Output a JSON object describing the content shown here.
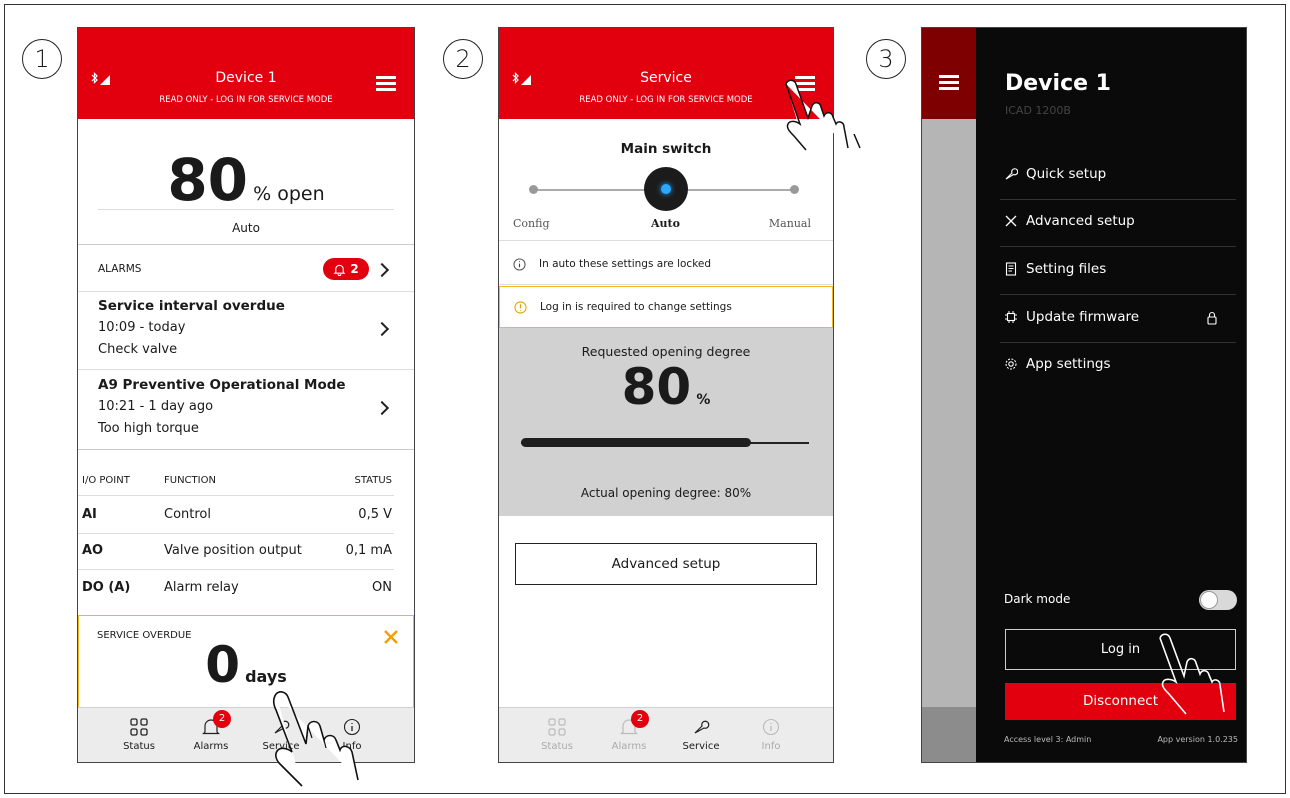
{
  "steps": [
    "1",
    "2",
    "3"
  ],
  "screen1": {
    "title": "Device 1",
    "subtitle": "READ ONLY - LOG IN FOR SERVICE MODE",
    "opening_value": "80",
    "opening_unit": "% open",
    "mode": "Auto",
    "alarms_label": "ALARMS",
    "alarm_count": "2",
    "alarms": [
      {
        "title": "Service interval overdue",
        "time": "10:09 - today",
        "detail": "Check valve"
      },
      {
        "title": "A9 Preventive Operational Mode",
        "time": "10:21 - 1 day ago",
        "detail": "Too high torque"
      }
    ],
    "io_headers": [
      "I/O POINT",
      "FUNCTION",
      "STATUS"
    ],
    "io_rows": [
      {
        "point": "AI",
        "function": "Control",
        "status": "0,5 V"
      },
      {
        "point": "AO",
        "function": "Valve position output",
        "status": "0,1 mA"
      },
      {
        "point": "DO (A)",
        "function": "Alarm relay",
        "status": "ON"
      }
    ],
    "service_label": "SERVICE OVERDUE",
    "service_value": "0",
    "service_unit": "days",
    "tabs": [
      "Status",
      "Alarms",
      "Service",
      "Info"
    ],
    "tab_badge": "2"
  },
  "screen2": {
    "title": "Service",
    "subtitle": "READ ONLY - LOG IN FOR SERVICE MODE",
    "switch_title": "Main switch",
    "switch_options": [
      "Config",
      "Auto",
      "Manual"
    ],
    "selected_option": "Auto",
    "locked_note": "In auto these settings are locked",
    "login_note": "Log in is required to change settings",
    "requested_label": "Requested opening degree",
    "requested_value": "80",
    "requested_unit": "%",
    "progress_percent": 80,
    "actual_label": "Actual opening degree: 80%",
    "advanced_button": "Advanced setup",
    "tabs": [
      "Status",
      "Alarms",
      "Service",
      "Info"
    ],
    "tab_badge": "2"
  },
  "screen3": {
    "device_title": "Device 1",
    "device_model": "ICAD 1200B",
    "menu": [
      "Quick setup",
      "Advanced setup",
      "Setting files",
      "Update firmware",
      "App settings"
    ],
    "dark_mode_label": "Dark mode",
    "login_button": "Log in",
    "disconnect_button": "Disconnect",
    "access_level": "Access level 3: Admin",
    "app_version": "App version 1.0.235"
  },
  "colors": {
    "brand_red": "#e2000f",
    "alert_yellow": "#f3b81b",
    "drawer_bg": "#0a0a0a"
  }
}
